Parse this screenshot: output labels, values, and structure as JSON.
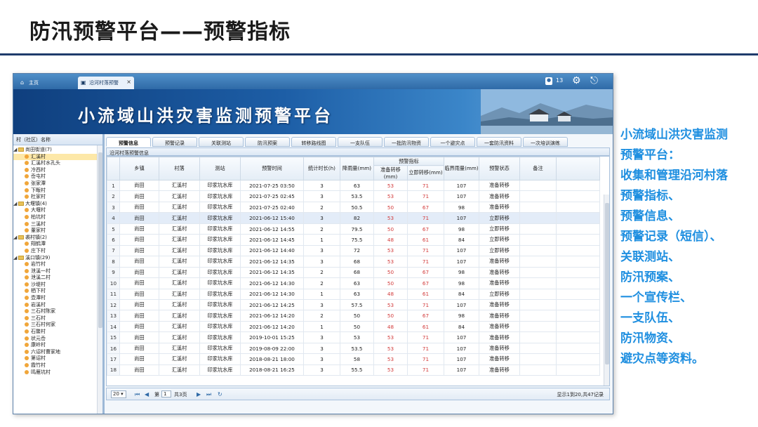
{
  "slide": {
    "title": "防汛预警平台——预警指标"
  },
  "app": {
    "tabs": [
      {
        "label": "主页"
      },
      {
        "label": "沿河村落预警"
      }
    ],
    "user_count": "13",
    "banner_title": "小流域山洪灾害监测预警平台"
  },
  "sidebar": {
    "header": "村（社区）名称",
    "tree": [
      {
        "label": "尚田街道(7)",
        "type": "group"
      },
      {
        "label": "汇溪村",
        "type": "leaf",
        "selected": true
      },
      {
        "label": "汇溪村水孔头",
        "type": "leaf"
      },
      {
        "label": "冷西村",
        "type": "leaf"
      },
      {
        "label": "岙屯村",
        "type": "leaf"
      },
      {
        "label": "张家潭",
        "type": "leaf"
      },
      {
        "label": "下畈村",
        "type": "leaf"
      },
      {
        "label": "杜家村",
        "type": "leaf"
      },
      {
        "label": "大堰镇(4)",
        "type": "group"
      },
      {
        "label": "大堰村",
        "type": "leaf"
      },
      {
        "label": "柏坑村",
        "type": "leaf"
      },
      {
        "label": "三溪村",
        "type": "leaf"
      },
      {
        "label": "董家村",
        "type": "leaf"
      },
      {
        "label": "裘村镇(2)",
        "type": "group"
      },
      {
        "label": "翔鹤潭",
        "type": "leaf"
      },
      {
        "label": "庄下村",
        "type": "leaf"
      },
      {
        "label": "溪口镇(29)",
        "type": "group"
      },
      {
        "label": "岩竹村",
        "type": "leaf"
      },
      {
        "label": "泄溪一村",
        "type": "leaf"
      },
      {
        "label": "泄溪二村",
        "type": "leaf"
      },
      {
        "label": "沙堤村",
        "type": "leaf"
      },
      {
        "label": "栖下村",
        "type": "leaf"
      },
      {
        "label": "壶潭村",
        "type": "leaf"
      },
      {
        "label": "岩溪村",
        "type": "leaf"
      },
      {
        "label": "三石村陈家",
        "type": "leaf"
      },
      {
        "label": "三石村",
        "type": "leaf"
      },
      {
        "label": "三石村何家",
        "type": "leaf"
      },
      {
        "label": "石鳖村",
        "type": "leaf"
      },
      {
        "label": "状元岙",
        "type": "leaf"
      },
      {
        "label": "康岭村",
        "type": "leaf"
      },
      {
        "label": "六诏村曹家地",
        "type": "leaf"
      },
      {
        "label": "第诏村",
        "type": "leaf"
      },
      {
        "label": "霞竹村",
        "type": "leaf"
      },
      {
        "label": "鸣雁坑村",
        "type": "leaf"
      }
    ]
  },
  "subtabs": [
    "预警信息",
    "预警记录",
    "关联测站",
    "防汛预案",
    "转移路线图",
    "一支队伍",
    "一批防汛物资",
    "一个避灾点",
    "一套防汛资料",
    "一次培训演练"
  ],
  "panel_title": "沿河村落预警信息",
  "table": {
    "headers": {
      "town": "乡镇",
      "village": "村落",
      "station": "测站",
      "time": "预警时间",
      "duration": "统计时长(h)",
      "rain": "降雨量(mm)",
      "index_group": "预警指标",
      "prepare": "准备转移(mm)",
      "immediate": "立即转移(mm)",
      "critical": "临界雨量(mm)",
      "status": "预警状态",
      "note": "备注"
    },
    "rows": [
      {
        "n": "1",
        "town": "尚田",
        "village": "汇溪村",
        "station": "印家坑水库",
        "time": "2021-07-25 03:50",
        "dur": "3",
        "rain": "63",
        "prep": "53",
        "imm": "71",
        "crit": "107",
        "status": "准备转移",
        "red": "prep"
      },
      {
        "n": "2",
        "town": "尚田",
        "village": "汇溪村",
        "station": "印家坑水库",
        "time": "2021-07-25 02:45",
        "dur": "3",
        "rain": "53.5",
        "prep": "53",
        "imm": "71",
        "crit": "107",
        "status": "准备转移",
        "red": "prep"
      },
      {
        "n": "3",
        "town": "尚田",
        "village": "汇溪村",
        "station": "印家坑水库",
        "time": "2021-07-25 02:40",
        "dur": "2",
        "rain": "50.5",
        "prep": "50",
        "imm": "67",
        "crit": "98",
        "status": "准备转移",
        "red": "prep"
      },
      {
        "n": "4",
        "town": "尚田",
        "village": "汇溪村",
        "station": "印家坑水库",
        "time": "2021-06-12 15:40",
        "dur": "3",
        "rain": "82",
        "prep": "53",
        "imm": "71",
        "crit": "107",
        "status": "立即转移",
        "red": "imm",
        "hl": true
      },
      {
        "n": "5",
        "town": "尚田",
        "village": "汇溪村",
        "station": "印家坑水库",
        "time": "2021-06-12 14:55",
        "dur": "2",
        "rain": "79.5",
        "prep": "50",
        "imm": "67",
        "crit": "98",
        "status": "立即转移",
        "red": "imm"
      },
      {
        "n": "6",
        "town": "尚田",
        "village": "汇溪村",
        "station": "印家坑水库",
        "time": "2021-06-12 14:45",
        "dur": "1",
        "rain": "75.5",
        "prep": "48",
        "imm": "61",
        "crit": "84",
        "status": "立即转移",
        "red": "imm"
      },
      {
        "n": "7",
        "town": "尚田",
        "village": "汇溪村",
        "station": "印家坑水库",
        "time": "2021-06-12 14:40",
        "dur": "3",
        "rain": "72",
        "prep": "53",
        "imm": "71",
        "crit": "107",
        "status": "立即转移",
        "red": "imm"
      },
      {
        "n": "8",
        "town": "尚田",
        "village": "汇溪村",
        "station": "印家坑水库",
        "time": "2021-06-12 14:35",
        "dur": "3",
        "rain": "68",
        "prep": "53",
        "imm": "71",
        "crit": "107",
        "status": "准备转移",
        "red": "prep"
      },
      {
        "n": "9",
        "town": "尚田",
        "village": "汇溪村",
        "station": "印家坑水库",
        "time": "2021-06-12 14:35",
        "dur": "2",
        "rain": "68",
        "prep": "50",
        "imm": "67",
        "crit": "98",
        "status": "准备转移",
        "red": "imm"
      },
      {
        "n": "10",
        "town": "尚田",
        "village": "汇溪村",
        "station": "印家坑水库",
        "time": "2021-06-12 14:30",
        "dur": "2",
        "rain": "63",
        "prep": "50",
        "imm": "67",
        "crit": "98",
        "status": "准备转移",
        "red": "prep"
      },
      {
        "n": "11",
        "town": "尚田",
        "village": "汇溪村",
        "station": "印家坑水库",
        "time": "2021-06-12 14:30",
        "dur": "1",
        "rain": "63",
        "prep": "48",
        "imm": "61",
        "crit": "84",
        "status": "立即转移",
        "red": "imm"
      },
      {
        "n": "12",
        "town": "尚田",
        "village": "汇溪村",
        "station": "印家坑水库",
        "time": "2021-06-12 14:25",
        "dur": "3",
        "rain": "57.5",
        "prep": "53",
        "imm": "71",
        "crit": "107",
        "status": "准备转移",
        "red": "prep"
      },
      {
        "n": "13",
        "town": "尚田",
        "village": "汇溪村",
        "station": "印家坑水库",
        "time": "2021-06-12 14:20",
        "dur": "2",
        "rain": "50",
        "prep": "50",
        "imm": "67",
        "crit": "98",
        "status": "准备转移",
        "red": "prep"
      },
      {
        "n": "14",
        "town": "尚田",
        "village": "汇溪村",
        "station": "印家坑水库",
        "time": "2021-06-12 14:20",
        "dur": "1",
        "rain": "50",
        "prep": "48",
        "imm": "61",
        "crit": "84",
        "status": "准备转移",
        "red": "prep"
      },
      {
        "n": "15",
        "town": "尚田",
        "village": "汇溪村",
        "station": "印家坑水库",
        "time": "2019-10-01 15:25",
        "dur": "3",
        "rain": "53",
        "prep": "53",
        "imm": "71",
        "crit": "107",
        "status": "准备转移",
        "red": "prep"
      },
      {
        "n": "16",
        "town": "尚田",
        "village": "汇溪村",
        "station": "印家坑水库",
        "time": "2019-08-09 22:00",
        "dur": "3",
        "rain": "53.5",
        "prep": "53",
        "imm": "71",
        "crit": "107",
        "status": "准备转移",
        "red": "prep"
      },
      {
        "n": "17",
        "town": "尚田",
        "village": "汇溪村",
        "station": "印家坑水库",
        "time": "2018-08-21 18:00",
        "dur": "3",
        "rain": "58",
        "prep": "53",
        "imm": "71",
        "crit": "107",
        "status": "准备转移",
        "red": "prep"
      },
      {
        "n": "18",
        "town": "尚田",
        "village": "汇溪村",
        "station": "印家坑水库",
        "time": "2018-08-21 16:25",
        "dur": "3",
        "rain": "55.5",
        "prep": "53",
        "imm": "71",
        "crit": "107",
        "status": "准备转移",
        "red": "prep"
      }
    ]
  },
  "pager": {
    "page_size": "20",
    "page_prefix": "第",
    "page_value": "1",
    "page_suffix": "共3页",
    "info": "显示1到20,共47记录"
  },
  "description": {
    "head_1": "小流域山洪灾害监测",
    "head_2": "预警平台：",
    "lines": [
      "收集和管理沿河村落",
      "预警指标、",
      "预警信息、",
      "预警记录（短信）、",
      "关联测站、",
      "防汛预案、",
      "一个宣传栏、",
      "一支队伍、",
      "防汛物资、",
      "避灾点等资料。"
    ]
  },
  "colors": {
    "accent_blue": "#1f8fe0",
    "warn_red": "#d23a3a",
    "banner_blue": "#1d5ea6"
  }
}
